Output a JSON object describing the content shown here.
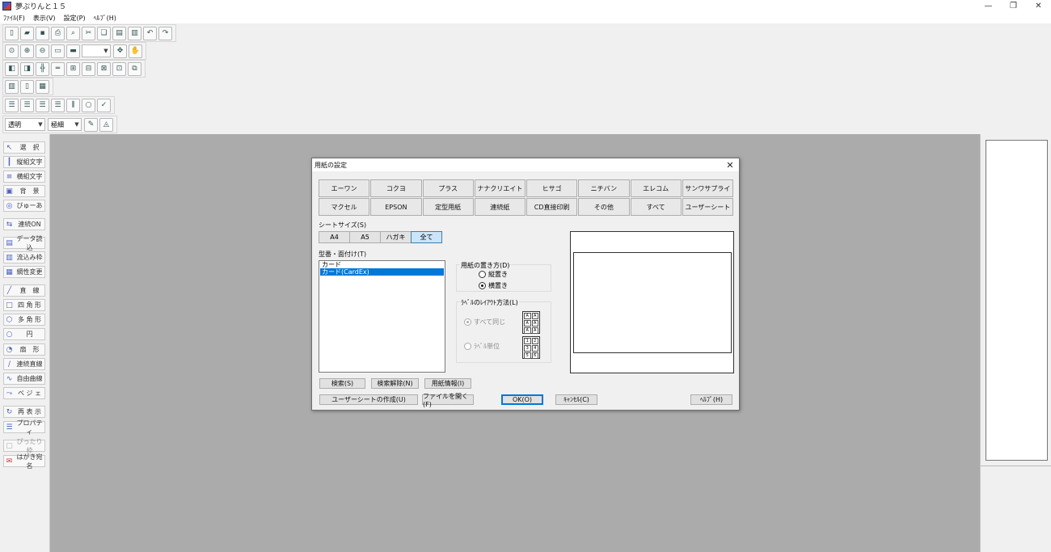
{
  "window": {
    "title": "夢ぷりんと１５",
    "minimize": "—",
    "restore": "❐",
    "close": "✕"
  },
  "menu": [
    "ﾌｧｲﾙ(F)",
    "表示(V)",
    "設定(P)",
    "ﾍﾙﾌﾟ(H)"
  ],
  "toolbar": {
    "zoom_value": "",
    "fill_select": "透明",
    "line_select": "極細"
  },
  "palette": [
    {
      "icon": "↖",
      "label": "選　択"
    },
    {
      "icon": "┃",
      "label": "縦組文字"
    },
    {
      "icon": "≡",
      "label": "横組文字"
    },
    {
      "icon": "▣",
      "label": "背　景"
    },
    {
      "icon": "◎",
      "label": "びゅーあ"
    },
    {
      "icon": "⇆",
      "label": "連続ON"
    },
    {
      "icon": "▤",
      "label": "データ読込"
    },
    {
      "icon": "▥",
      "label": "流込み枠"
    },
    {
      "icon": "▦",
      "label": "網性変更"
    },
    {
      "icon": "╱",
      "label": "直　線"
    },
    {
      "icon": "□",
      "label": "四 角 形"
    },
    {
      "icon": "⬡",
      "label": "多 角 形"
    },
    {
      "icon": "○",
      "label": "円"
    },
    {
      "icon": "◔",
      "label": "扇　形"
    },
    {
      "icon": "∕",
      "label": "連続直線"
    },
    {
      "icon": "∿",
      "label": "自由曲線"
    },
    {
      "icon": "⤳",
      "label": "ベ ジ ェ"
    },
    {
      "icon": "↻",
      "label": "再 表 示"
    },
    {
      "icon": "☰",
      "label": "プロパティ"
    },
    {
      "icon": "▢",
      "label": "ぴったり枠"
    },
    {
      "icon": "✉",
      "label": "はがき宛名"
    }
  ],
  "dialog": {
    "title": "用紙の設定",
    "makers": [
      "エーワン",
      "コクヨ",
      "プラス",
      "ナナクリエイト",
      "ヒサゴ",
      "ニチバン",
      "エレコム",
      "サンワサプライ",
      "マクセル",
      "EPSON",
      "定型用紙",
      "連続紙",
      "CD直接印刷",
      "その他",
      "すべて",
      "ユーザーシート"
    ],
    "sheet_size_label": "シートサイズ(S)",
    "sheet_sizes": [
      "A4",
      "A5",
      "ハガキ",
      "全て"
    ],
    "selected_sheet": "全て",
    "model_label": "型番・面付け(T)",
    "models": [
      "カード",
      "カード(CardEx)"
    ],
    "selected_model": "カード(CardEx)",
    "orientation": {
      "title": "用紙の置き方(D)",
      "portrait": "縦置き",
      "landscape": "横置き",
      "selected": "横置き"
    },
    "layout": {
      "title": "ﾗﾍﾞﾙのﾚｲｱｳﾄ方法(L)",
      "all_same": "すべて同じ",
      "per_label": "ﾗﾍﾞﾙ単位",
      "selected": "すべて同じ",
      "icon_same": [
        "A",
        "A",
        "A",
        "A",
        "A",
        "A"
      ],
      "icon_unit": [
        "1",
        "2",
        "3",
        "4",
        "5",
        "6"
      ]
    },
    "buttons": {
      "search": "検索(S)",
      "clear_search": "検索解除(N)",
      "paper_info": "用紙情報(I)",
      "create_user_sheet": "ユーザーシートの作成(U)",
      "open_file": "ファイルを開く(F)",
      "ok": "OK(O)",
      "cancel": "ｷｬﾝｾﾙ(C)",
      "help": "ﾍﾙﾌﾟ(H)"
    }
  }
}
